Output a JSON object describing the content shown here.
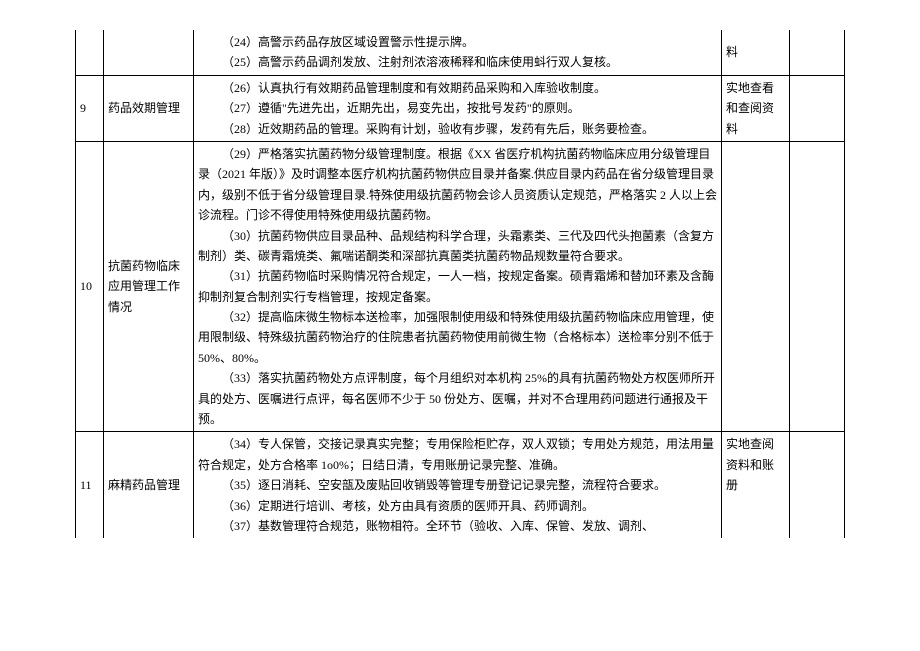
{
  "rows": [
    {
      "num": "",
      "name": "",
      "content": [
        "（24）高警示药品存放区域设置警示性提示牌。",
        "（25）高警示药品调剂发放、注射剂浓溶液稀释和临床使用蚪行双人复核。"
      ],
      "method": "料",
      "partial": true
    },
    {
      "num": "9",
      "name": "药品效期管理",
      "content": [
        "（26）认真执行有效期药品管理制度和有效期药品采购和入库验收制度。",
        "（27）遵循\"先进先出，近期先出，易变先出，按批号发药\"的原则。",
        "（28）近效期药品的管理。采购有计划，验收有步骤，发药有先后，账务要检查。"
      ],
      "method": "实地查看和查阅资料"
    },
    {
      "num": "10",
      "name": "抗菌药物临床应用管理工作情况",
      "content": [
        "（29）严格落实抗菌药物分级管理制度。根据《XX 省医疗机构抗菌药物临床应用分级管理目录（2021 年版）》及时调整本医疗机构抗菌药物供应目录并备案.供应目录内药品在省分级管理目录内，级别不低于省分级管理目录.特殊使用级抗菌药物会诊人员资质认定规范，严格落实 2 人以上会诊流程。门诊不得使用特殊使用级抗菌药物。",
        "（30）抗菌药物供应目录品种、品规结构科学合理，头霜素类、三代及四代头抱菌素（含复方制剂）类、碳青霜焼类、氟喘诺酮类和深部抗真菌类抗菌药物品规数量符合要求。",
        "（31）抗菌药物临时采购情况符合规定，一人一档，按规定备案。硕青霜烯和替加环素及含酶抑制剂复合制剂实行专档管理，按规定备案。",
        "（32）提高临床微生物标本送检率，加强限制使用级和特殊使用级抗菌药物临床应用管理，使用限制级、特殊级抗菌药物治疗的住院患者抗菌药物使用前微生物（合格标本）送检率分别不低于 50%、80%。",
        "（33）落实抗菌药物处方点评制度，每个月组织对本机构 25%的具有抗菌药物处方权医师所开具的处方、医嘱进行点评，每名医师不少于 50 份处方、医嘱，并对不合理用药问题进行通报及干预。"
      ],
      "method": ""
    },
    {
      "num": "11",
      "name": "麻精药品管理",
      "content": [
        "（34）专人保管，交接记录真实完整；专用保险柜贮存，双人双锁；专用处方规范，用法用量符合规定，处方合格率 1o0%；日结日清，专用账册记录完整、准确。",
        "（35）逐日消耗、空安瓿及废贴回收销毁等管理专册登记记录完整，流程符合要求。",
        "（36）定期进行培训、考核，处方由具有资质的医师开具、药师调剂。",
        "（37）基数管理符合规范，账物相符。全环节（验收、入库、保管、发放、调剂、"
      ],
      "method": "实地查阅资料和账册",
      "partialBottom": true
    }
  ]
}
